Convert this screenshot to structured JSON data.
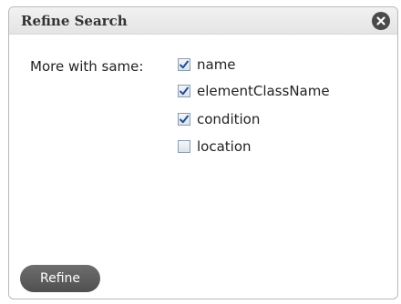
{
  "dialog": {
    "title": "Refine Search",
    "close_icon": "close-icon",
    "more_with_same_label": "More with same:",
    "options": [
      {
        "label": "name",
        "checked": true
      },
      {
        "label": "elementClassName",
        "checked": true
      },
      {
        "label": "condition",
        "checked": true
      },
      {
        "label": "location",
        "checked": false
      }
    ],
    "refine_label": "Refine"
  },
  "colors": {
    "titlebar": "#e8e8e8",
    "close_button": "#4a4a4a",
    "refine_button": "#5e5e5e",
    "checkmark": "#1f4f9a"
  }
}
